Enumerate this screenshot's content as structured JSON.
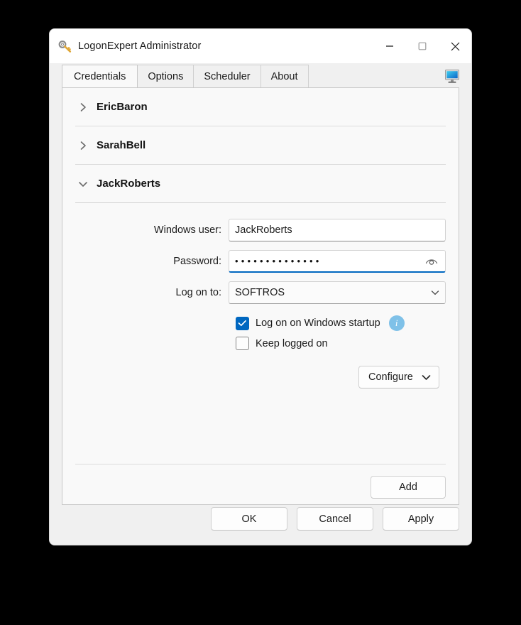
{
  "window": {
    "title": "LogonExpert Administrator",
    "app_icon": "key-icon",
    "controls": {
      "minimize": "minimize-icon",
      "maximize": "maximize-icon",
      "close": "close-icon"
    }
  },
  "tabs": [
    {
      "label": "Credentials",
      "active": true
    },
    {
      "label": "Options",
      "active": false
    },
    {
      "label": "Scheduler",
      "active": false
    },
    {
      "label": "About",
      "active": false
    }
  ],
  "tabstrip": {
    "trailing_icon": "monitor-icon"
  },
  "accounts": [
    {
      "name": "EricBaron",
      "expanded": false,
      "chevron": "chevron-right-icon"
    },
    {
      "name": "SarahBell",
      "expanded": false,
      "chevron": "chevron-right-icon"
    },
    {
      "name": "JackRoberts",
      "expanded": true,
      "chevron": "chevron-down-icon"
    }
  ],
  "form": {
    "windows_user": {
      "label": "Windows user:",
      "value": "JackRoberts",
      "focused": false
    },
    "password": {
      "label": "Password:",
      "value": "••••••••••••••",
      "dot_count": 14,
      "focused": true,
      "reveal_icon": "eye-icon"
    },
    "log_on_to": {
      "label": "Log on to:",
      "value": "SOFTROS",
      "chevron": "chevron-down-icon",
      "options": [
        "SOFTROS"
      ]
    },
    "startup_checkbox": {
      "label": "Log on on Windows startup",
      "checked": true,
      "info_icon": "info-icon",
      "info_glyph": "i"
    },
    "keep_logged_checkbox": {
      "label": "Keep logged on",
      "checked": false
    },
    "configure_button": {
      "label": "Configure",
      "chevron": "chevron-down-icon"
    },
    "add_button": {
      "label": "Add"
    }
  },
  "footer": {
    "ok": "OK",
    "cancel": "Cancel",
    "apply": "Apply"
  },
  "colors": {
    "accent": "#0067c0",
    "info_badge": "#7fc1e8",
    "window_chrome": "#f0f0f0",
    "panel_background": "#f9f9f9",
    "close_hover": "#e81123"
  }
}
